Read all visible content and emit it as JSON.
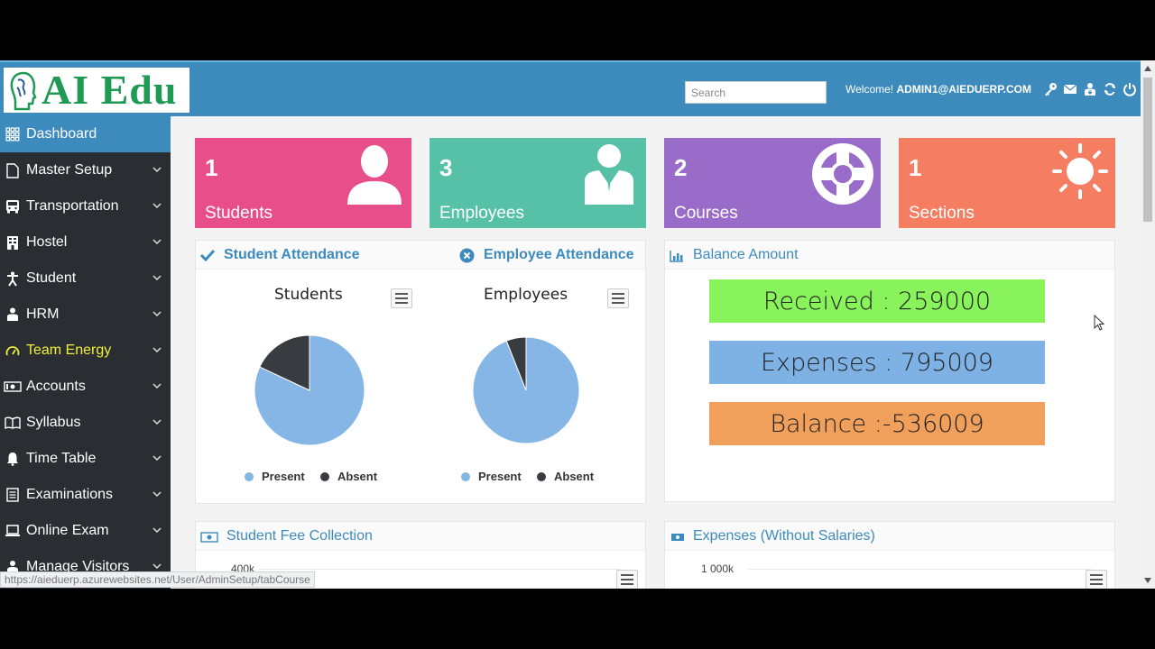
{
  "header": {
    "logo_text": "AI Edu",
    "search_placeholder": "Search",
    "welcome_label": "Welcome!",
    "user": "ADMIN1@AIEDUERP.COM",
    "icons": [
      "key-icon",
      "mail-icon",
      "user-download-icon",
      "refresh-icon",
      "power-icon"
    ]
  },
  "sidebar": {
    "items": [
      {
        "label": "Dashboard",
        "icon": "grid-icon",
        "active": true
      },
      {
        "label": "Master Setup",
        "icon": "file-icon"
      },
      {
        "label": "Transportation",
        "icon": "bus-icon"
      },
      {
        "label": "Hostel",
        "icon": "building-icon"
      },
      {
        "label": "Student",
        "icon": "student-icon"
      },
      {
        "label": "HRM",
        "icon": "hrm-icon"
      },
      {
        "label": "Team Energy",
        "icon": "gauge-icon",
        "highlight": "#f0ef3a"
      },
      {
        "label": "Accounts",
        "icon": "money-icon"
      },
      {
        "label": "Syllabus",
        "icon": "book-icon"
      },
      {
        "label": "Time Table",
        "icon": "bell-icon"
      },
      {
        "label": "Examinations",
        "icon": "list-icon"
      },
      {
        "label": "Online Exam",
        "icon": "laptop-icon"
      },
      {
        "label": "Manage Visitors",
        "icon": "visitor-icon"
      }
    ]
  },
  "tiles": [
    {
      "count": "1",
      "label": "Students",
      "color": "#e84f8a",
      "icon": "user-icon"
    },
    {
      "count": "3",
      "label": "Employees",
      "color": "#56c1a6",
      "icon": "employee-icon"
    },
    {
      "count": "2",
      "label": "Courses",
      "color": "#9a6cc9",
      "icon": "lifebuoy-icon"
    },
    {
      "count": "1",
      "label": "Sections",
      "color": "#f47d62",
      "icon": "sun-icon"
    }
  ],
  "attendance": {
    "student_title": "Student Attendance",
    "employee_title": "Employee Attendance",
    "legend_present": "Present",
    "legend_absent": "Absent",
    "colors": {
      "present": "#86b6e6",
      "absent": "#383b3f"
    }
  },
  "chart_data": [
    {
      "type": "pie",
      "title": "Students",
      "categories": [
        "Present",
        "Absent"
      ],
      "values": [
        82,
        18
      ]
    },
    {
      "type": "pie",
      "title": "Employees",
      "categories": [
        "Present",
        "Absent"
      ],
      "values": [
        94,
        6
      ]
    }
  ],
  "balance": {
    "title": "Balance Amount",
    "received": "Received : 259000",
    "expenses": "Expenses : 795009",
    "balance": "Balance :-536009",
    "colors": {
      "received": "#89f35b",
      "expenses": "#7fb2e4",
      "balance": "#f0a05a"
    }
  },
  "fee": {
    "title": "Student Fee Collection",
    "axis_top": "400k"
  },
  "expenses_panel": {
    "title": "Expenses (Without Salaries)",
    "axis_top": "1 000k"
  },
  "status_url": "https://aieduerp.azurewebsites.net/User/AdminSetup/tabCourse"
}
